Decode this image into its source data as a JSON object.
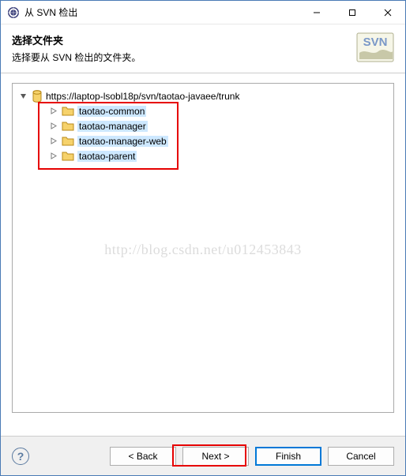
{
  "titlebar": {
    "title": "从 SVN 检出"
  },
  "header": {
    "heading": "选择文件夹",
    "subheading": "选择要从 SVN 检出的文件夹。",
    "logo_text": "SVN"
  },
  "tree": {
    "root": {
      "url": "https://laptop-lsobl18p/svn/taotao-javaee/trunk",
      "children": [
        {
          "label": "taotao-common"
        },
        {
          "label": "taotao-manager"
        },
        {
          "label": "taotao-manager-web"
        },
        {
          "label": "taotao-parent"
        }
      ]
    }
  },
  "watermark": "http://blog.csdn.net/u012453843",
  "buttons": {
    "back": "< Back",
    "next": "Next >",
    "finish": "Finish",
    "cancel": "Cancel"
  }
}
